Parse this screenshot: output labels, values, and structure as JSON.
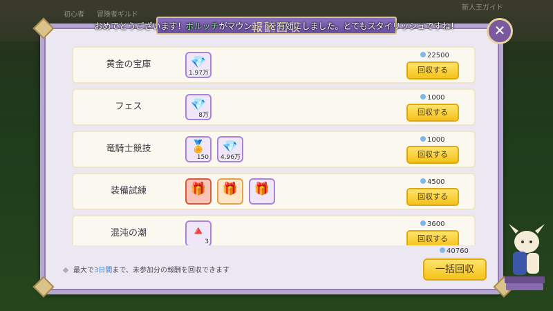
{
  "background": {
    "hud": [
      "初心者",
      "冒険者ギルド",
      "新人王ガイド"
    ]
  },
  "modal": {
    "title": "報酬回収",
    "toast_prefix": "おめでとうございます！",
    "toast_highlight": "ボルッチ",
    "toast_suffix": "がマウント「を有効にしました。とてもスタイリッシュですね！",
    "close_icon": "close-icon"
  },
  "rows": [
    {
      "name": "黄金の宝庫",
      "cost": "22500",
      "button": "回収する",
      "items": [
        {
          "icon": "exp-crystal-icon",
          "glyph": "💎",
          "qty": "1.97万",
          "style": "purple"
        }
      ]
    },
    {
      "name": "フェス",
      "cost": "1000",
      "button": "回収する",
      "items": [
        {
          "icon": "exp-crystal-icon",
          "glyph": "💎",
          "qty": "8万",
          "style": "purple"
        }
      ]
    },
    {
      "name": "竜騎士競技",
      "cost": "1000",
      "button": "回収する",
      "items": [
        {
          "icon": "medal-icon",
          "glyph": "🏅",
          "qty": "150",
          "style": "purple"
        },
        {
          "icon": "exp-crystal-icon",
          "glyph": "💎",
          "qty": "4.96万",
          "style": "purple"
        }
      ]
    },
    {
      "name": "装備試練",
      "cost": "4500",
      "button": "回収する",
      "items": [
        {
          "icon": "gift-box-icon",
          "glyph": "🎁",
          "qty": "",
          "style": "red"
        },
        {
          "icon": "gift-box-icon",
          "glyph": "🎁",
          "qty": "",
          "style": "orange"
        },
        {
          "icon": "gift-box-icon",
          "glyph": "🎁",
          "qty": "",
          "style": "purple"
        }
      ]
    },
    {
      "name": "混沌の潮",
      "cost": "3600",
      "button": "回収する",
      "items": [
        {
          "icon": "red-triangle-icon",
          "glyph": "🔺",
          "qty": "3",
          "style": "purple"
        }
      ]
    }
  ],
  "footer": {
    "note_prefix": "最大で",
    "note_days": "3日間",
    "note_suffix": "まで、未参加分の報酬を回収できます",
    "total_cost": "40760",
    "collect_all": "一括回収"
  }
}
